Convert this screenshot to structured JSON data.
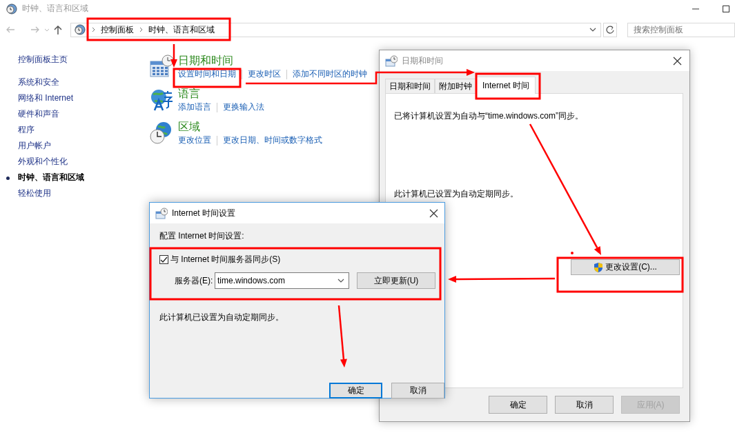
{
  "window": {
    "title": "时钟、语言和区域"
  },
  "address_bar": {
    "breadcrumbs": [
      "控制面板",
      "时钟、语言和区域"
    ]
  },
  "search": {
    "placeholder": "搜索控制面板"
  },
  "sidebar": {
    "items": [
      {
        "label": "控制面板主页",
        "selected": false
      },
      {
        "label": "系统和安全",
        "selected": false
      },
      {
        "label": "网络和 Internet",
        "selected": false
      },
      {
        "label": "硬件和声音",
        "selected": false
      },
      {
        "label": "程序",
        "selected": false
      },
      {
        "label": "用户帐户",
        "selected": false
      },
      {
        "label": "外观和个性化",
        "selected": false
      },
      {
        "label": "时钟、语言和区域",
        "selected": true
      },
      {
        "label": "轻松使用",
        "selected": false
      }
    ]
  },
  "categories": [
    {
      "kind": "calendar",
      "title": "日期和时间",
      "links": [
        "设置时间和日期",
        "更改时区",
        "添加不同时区的时钟"
      ]
    },
    {
      "kind": "language",
      "title": "语言",
      "links": [
        "添加语言",
        "更换输入法"
      ]
    },
    {
      "kind": "region",
      "title": "区域",
      "links": [
        "更改位置",
        "更改日期、时间或数字格式"
      ]
    }
  ],
  "datetime_dialog": {
    "title": "日期和时间",
    "tabs": [
      {
        "label": "日期和时间",
        "selected": false
      },
      {
        "label": "附加时钟",
        "selected": false
      },
      {
        "label": "Internet 时间",
        "selected": true
      }
    ],
    "sync_message": "已将计算机设置为自动与“time.windows.com”同步。",
    "schedule_message": "此计算机已设置为自动定期同步。",
    "change_button": "更改设置(C)...",
    "buttons": [
      {
        "label": "确定",
        "disabled": false
      },
      {
        "label": "取消",
        "disabled": false
      },
      {
        "label": "应用(A)",
        "disabled": true
      }
    ]
  },
  "internet_time_dialog": {
    "title": "Internet 时间设置",
    "heading": "配置 Internet 时间设置:",
    "sync_checkbox": {
      "label": "与 Internet 时间服务器同步(S)",
      "checked": true
    },
    "server": {
      "label": "服务器(E):",
      "value": "time.windows.com"
    },
    "update_button": "立即更新(U)",
    "status": "此计算机已设置为自动定期同步。",
    "buttons": [
      {
        "label": "确定",
        "default": true
      },
      {
        "label": "取消",
        "default": false
      }
    ]
  }
}
